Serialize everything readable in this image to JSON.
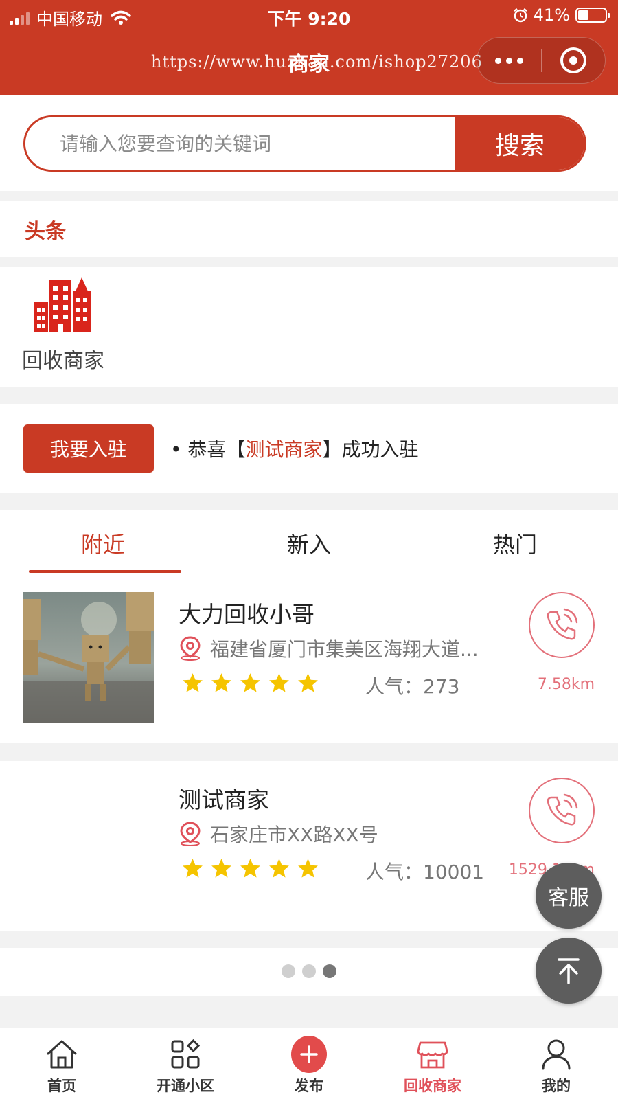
{
  "status_bar": {
    "carrier": "中国移动",
    "time": "下午 9:20",
    "battery": "41%"
  },
  "header": {
    "title": "商家",
    "watermark": "https://www.huzhan.com/ishop27206",
    "more_icon": "more-dots-icon",
    "close_icon": "target-circle-icon"
  },
  "search": {
    "placeholder": "请输入您要查询的关键词",
    "button_label": "搜索"
  },
  "headline": {
    "title": "头条"
  },
  "categories": [
    {
      "label": "回收商家",
      "icon": "buildings-icon"
    }
  ],
  "notice": {
    "join_button": "我要入驻",
    "prefix": "• 恭喜【",
    "merchant": "测试商家",
    "suffix": "】成功入驻"
  },
  "tabs": [
    {
      "label": "附近",
      "active": true
    },
    {
      "label": "新入",
      "active": false
    },
    {
      "label": "热门",
      "active": false
    }
  ],
  "merchants": [
    {
      "name": "大力回收小哥",
      "address": "福建省厦门市集美区海翔大道...",
      "rating": 5,
      "popularity_label": "人气：",
      "popularity": "273",
      "distance": "7.58km",
      "has_image": true
    },
    {
      "name": "测试商家",
      "address": "石家庄市XX路XX号",
      "rating": 5,
      "popularity_label": "人气：",
      "popularity": "10001",
      "distance": "1529.15km",
      "has_image": false
    }
  ],
  "pager": {
    "total": 3,
    "active": 3
  },
  "floating": {
    "service_label": "客服",
    "top_icon": "back-to-top-icon"
  },
  "bottom_nav": [
    {
      "label": "首页",
      "icon": "home-icon",
      "active": false
    },
    {
      "label": "开通小区",
      "icon": "grid-apps-icon",
      "active": false
    },
    {
      "label": "发布",
      "icon": "plus-circle-icon",
      "active": false
    },
    {
      "label": "回收商家",
      "icon": "shop-icon",
      "active": true
    },
    {
      "label": "我的",
      "icon": "user-icon",
      "active": false
    }
  ],
  "colors": {
    "brand": "#c93a24",
    "accent_pink": "#e3707a",
    "star": "#f5c400"
  }
}
